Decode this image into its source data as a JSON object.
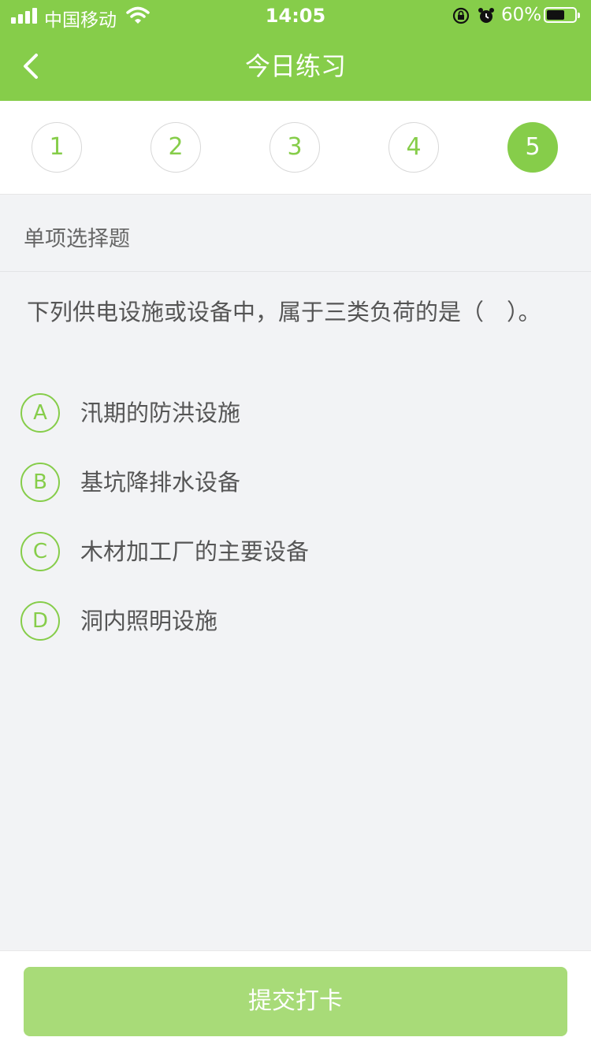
{
  "status": {
    "carrier": "中国移动",
    "time": "14:05",
    "battery": "60%",
    "battery_level": 0.6,
    "icons": [
      "signal-icon",
      "wifi-icon",
      "orientation-lock-icon",
      "alarm-icon",
      "battery-icon"
    ]
  },
  "header": {
    "title": "今日练习",
    "back_icon": "chevron-left-icon"
  },
  "steps": {
    "items": [
      "1",
      "2",
      "3",
      "4",
      "5"
    ],
    "active_index": 4
  },
  "question": {
    "type": "单项选择题",
    "text": "下列供电设施或设备中，属于三类负荷的是（　）。",
    "options": [
      {
        "letter": "A",
        "text": "汛期的防洪设施"
      },
      {
        "letter": "B",
        "text": "基坑降排水设备"
      },
      {
        "letter": "C",
        "text": "木材加工厂的主要设备"
      },
      {
        "letter": "D",
        "text": "洞内照明设施"
      }
    ]
  },
  "footer": {
    "submit_label": "提交打卡"
  },
  "colors": {
    "accent": "#86cd4a",
    "submit_disabled": "#a8db78",
    "background": "#f2f3f5"
  }
}
